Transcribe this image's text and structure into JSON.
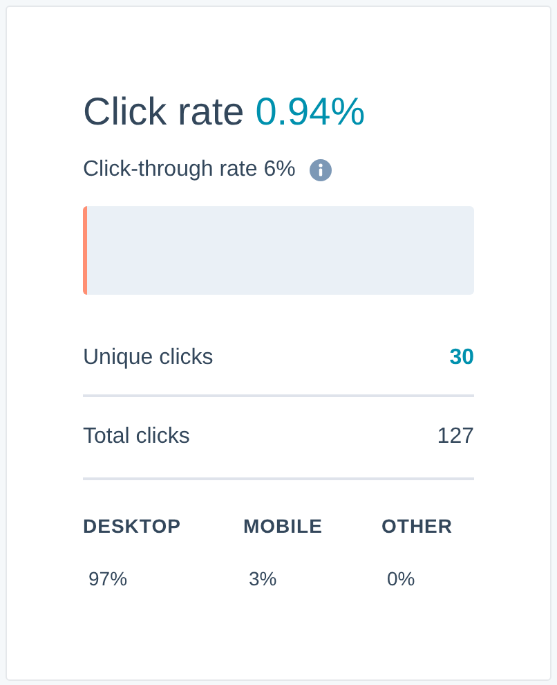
{
  "title": {
    "label": "Click rate",
    "value": "0.94%"
  },
  "subtitle": "Click-through rate 6%",
  "bar": {
    "level": 0.0094
  },
  "metrics": [
    {
      "label": "Unique clicks",
      "value": "30",
      "highlighted": true
    },
    {
      "label": "Total clicks",
      "value": "127",
      "highlighted": false
    }
  ],
  "devices": [
    {
      "label": "DESKTOP",
      "value": "97%"
    },
    {
      "label": "MOBILE",
      "value": "3%"
    },
    {
      "label": "OTHER",
      "value": "0%"
    }
  ]
}
